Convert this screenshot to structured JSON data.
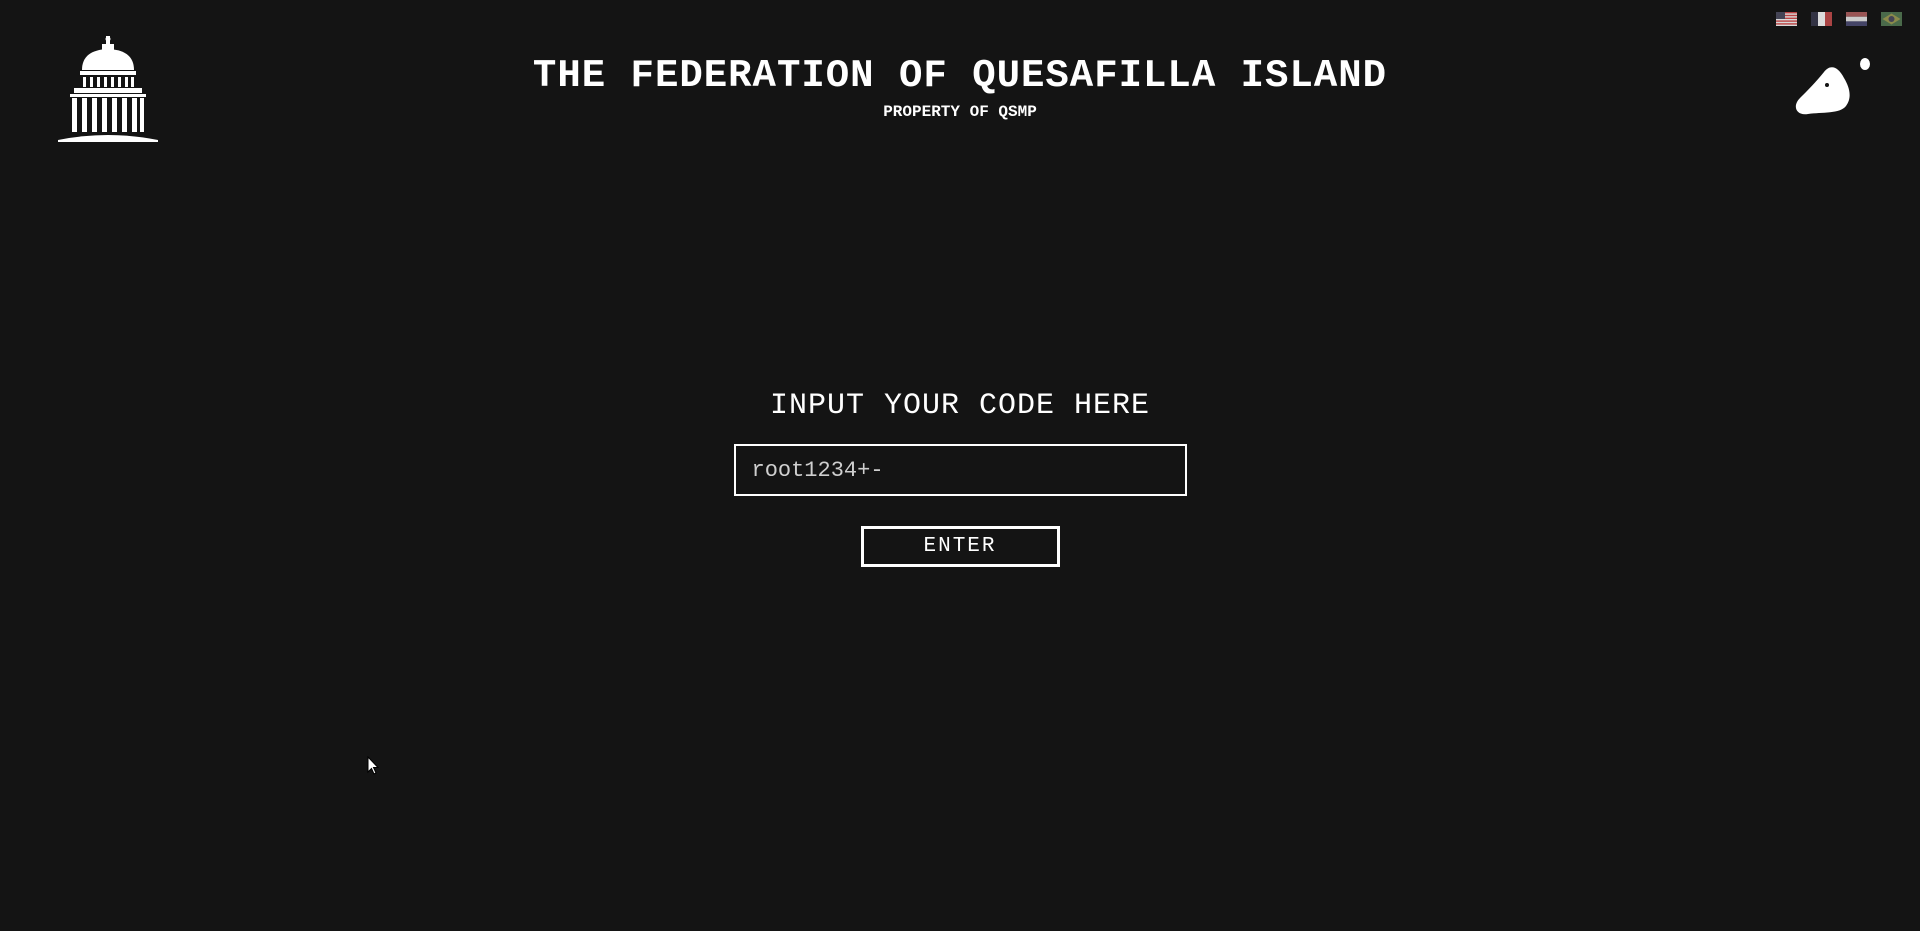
{
  "header": {
    "title": "THE FEDERATION OF QUESAFILLA ISLAND",
    "subtitle": "PROPERTY OF QSMP"
  },
  "logos": {
    "left": "capitol-building-icon",
    "right": "blob-icon"
  },
  "language_flags": [
    {
      "name": "us-flag-icon"
    },
    {
      "name": "france-flag-icon"
    },
    {
      "name": "netherlands-flag-icon"
    },
    {
      "name": "brazil-flag-icon"
    }
  ],
  "form": {
    "prompt": "INPUT YOUR CODE HERE",
    "code_value": "root1234+-",
    "enter_label": "ENTER"
  },
  "colors": {
    "background": "#141414",
    "foreground": "#ffffff"
  }
}
